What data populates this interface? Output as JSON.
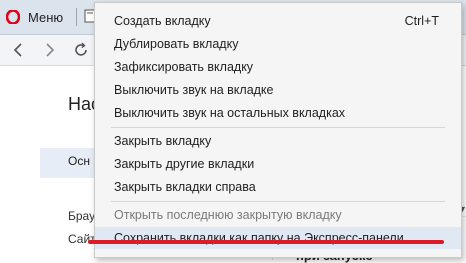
{
  "browser": {
    "menu_label": "Меню",
    "brand_color": "#e3001b"
  },
  "page": {
    "heading": "Нас",
    "sidebar_item": "Осн",
    "line1": "Брау",
    "line2": "Сайт",
    "bottom_text": "при запуске"
  },
  "context_menu": {
    "items": [
      {
        "label": "Создать вкладку",
        "shortcut": "Ctrl+T"
      },
      {
        "label": "Дублировать вкладку"
      },
      {
        "label": "Зафиксировать вкладку"
      },
      {
        "label": "Выключить звук на вкладке"
      },
      {
        "label": "Выключить звук на остальных вкладках"
      },
      {
        "label": "Закрыть вкладку"
      },
      {
        "label": "Закрыть другие вкладки"
      },
      {
        "label": "Закрыть вкладки справа"
      },
      {
        "label": "Открыть последнюю закрытую вкладку",
        "disabled": true
      },
      {
        "label": "Сохранить вкладки как папку на Экспресс-панели",
        "hovered": true
      }
    ],
    "annotation_color": "#d91b2a"
  }
}
